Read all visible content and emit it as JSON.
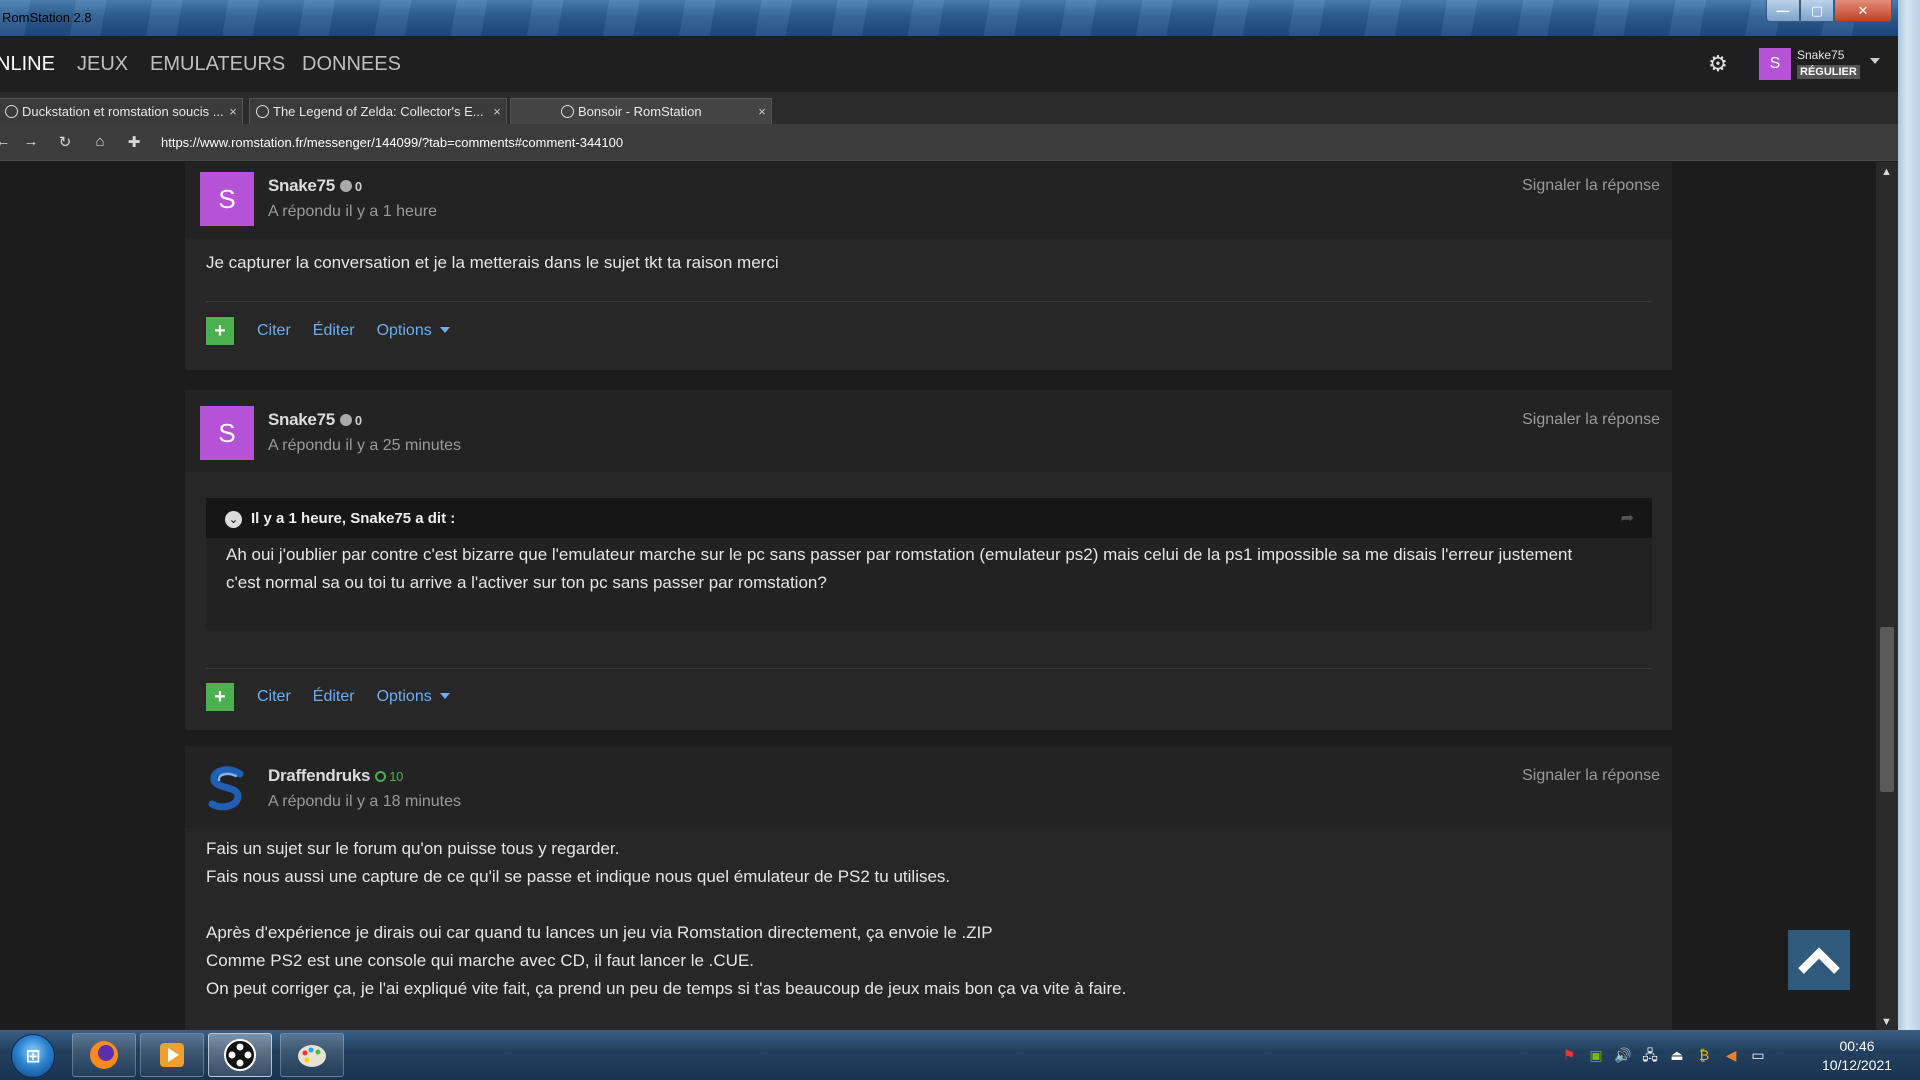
{
  "window": {
    "title": "RomStation 2.8"
  },
  "nav": {
    "online": "NLINE",
    "jeux": "JEUX",
    "emulateurs": "EMULATEURS",
    "donnees": "DONNEES"
  },
  "user": {
    "avatar_letter": "S",
    "name": "Snake75",
    "rank": "RÉGULIER"
  },
  "tabs": [
    {
      "label": "Duckstation et romstation soucis ...",
      "close": "×"
    },
    {
      "label": "The Legend of Zelda: Collector's E...",
      "close": "×"
    },
    {
      "label": "Bonsoir - RomStation",
      "close": "×"
    }
  ],
  "address": {
    "url": "https://www.romstation.fr/messenger/144099/?tab=comments#comment-344100"
  },
  "common": {
    "report": "Signaler la réponse",
    "quote": "Citer",
    "edit": "Éditer",
    "options": "Options",
    "plus": "+"
  },
  "posts": [
    {
      "author": "Snake75",
      "avatar_letter": "S",
      "reputation": "0",
      "replied": "A répondu il y a 1 heure",
      "body": [
        "Je capturer la conversation et je la metterais dans le sujet tkt ta raison merci"
      ]
    },
    {
      "author": "Snake75",
      "avatar_letter": "S",
      "reputation": "0",
      "replied": "A répondu il y a 25 minutes",
      "quote": {
        "header": "Il y a 1 heure, Snake75 a dit :",
        "lines": [
          "Ah oui j'oublier par contre c'est bizarre que l'emulateur marche sur le pc sans passer par romstation (emulateur ps2) mais celui de la ps1 impossible sa me disais l'erreur justement",
          "c'est normal sa ou toi tu arrive a l'activer sur ton pc sans passer par romstation?"
        ]
      }
    },
    {
      "author": "Draffendruks",
      "reputation": "10",
      "replied": "A répondu il y a 18 minutes",
      "body": [
        "Fais un sujet sur le forum qu'on puisse tous y regarder.",
        "Fais nous aussi une capture de ce qu'il se passe et indique nous quel émulateur de PS2 tu utilises.",
        "",
        "Après d'expérience je dirais oui car quand tu lances un jeu via Romstation directement, ça envoie le .ZIP",
        "Comme PS2 est une console qui marche avec CD, il faut lancer le .CUE.",
        "On peut corriger ça, je l'ai expliqué vite fait, ça prend un peu de temps si t'as beaucoup de jeux mais bon ça va vite à faire."
      ]
    }
  ],
  "clock": {
    "time": "00:46",
    "date": "10/12/2021"
  },
  "colors": {
    "accent_link": "#6aaef5",
    "avatar_purple": "#b552d8",
    "success_green": "#4caf50"
  }
}
